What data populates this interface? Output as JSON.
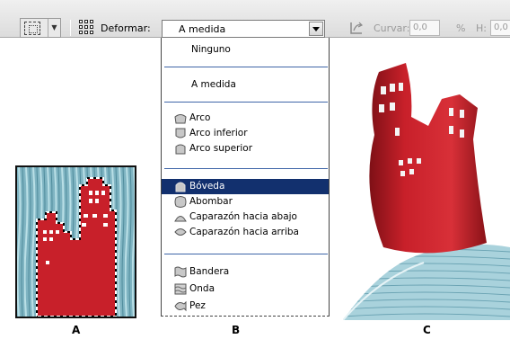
{
  "toolbar": {
    "warp_label": "Deformar:",
    "warp_value": "A medida",
    "curve_label": "Curvar:",
    "curve_value": "0,0",
    "percent": "%",
    "h_label": "H:",
    "h_value": "0,0"
  },
  "warp_menu": {
    "items": [
      {
        "label": "Ninguno",
        "icon": "none"
      },
      {
        "label": "A medida",
        "icon": "none"
      },
      {
        "label": "Arco",
        "icon": "arc-icon"
      },
      {
        "label": "Arco inferior",
        "icon": "arc-lower-icon"
      },
      {
        "label": "Arco superior",
        "icon": "arc-upper-icon"
      },
      {
        "label": "Bóveda",
        "icon": "arch-icon",
        "selected": true
      },
      {
        "label": "Abombar",
        "icon": "bulge-icon"
      },
      {
        "label": "Caparazón hacia abajo",
        "icon": "shell-lower-icon"
      },
      {
        "label": "Caparazón hacia arriba",
        "icon": "shell-upper-icon"
      },
      {
        "label": "Bandera",
        "icon": "flag-icon"
      },
      {
        "label": "Onda",
        "icon": "wave-icon"
      },
      {
        "label": "Pez",
        "icon": "fish-icon"
      }
    ]
  },
  "captions": {
    "a": "A",
    "b": "B",
    "c": "C"
  },
  "colors": {
    "selection": "#12306e",
    "divider": "#3f66a8",
    "building_red": "#c8202a",
    "water_blue": "#8fc3cf"
  }
}
